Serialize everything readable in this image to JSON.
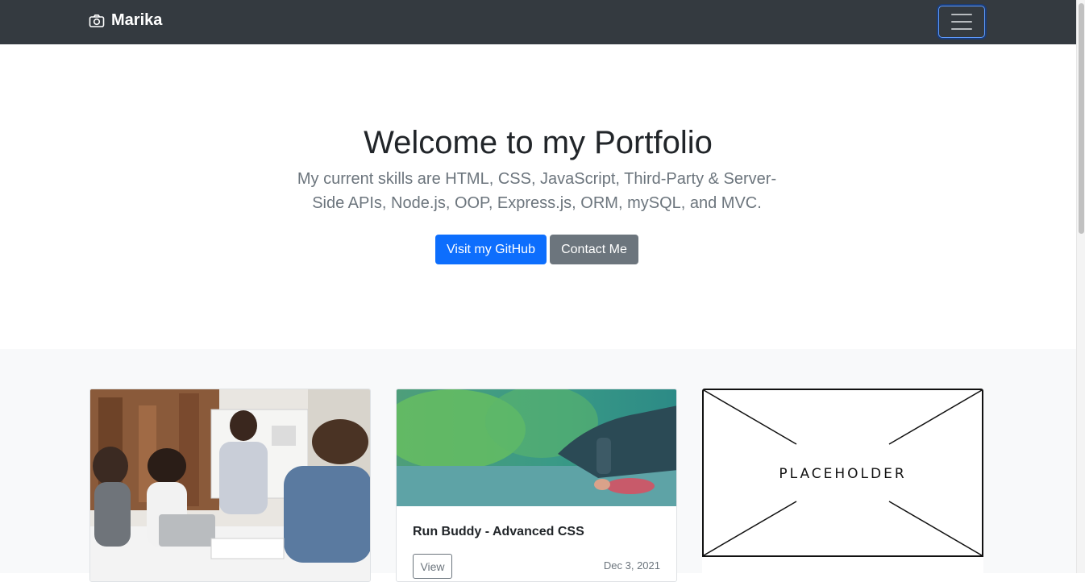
{
  "navbar": {
    "brand": "Marika",
    "brand_icon": "camera-icon",
    "toggler_icon": "hamburger-icon"
  },
  "hero": {
    "title": "Welcome to my Portfolio",
    "lead": "My current skills are HTML, CSS, JavaScript, Third-Party & Server-Side APIs, Node.js, OOP, Express.js, ORM, mySQL, and MVC.",
    "primary_button": "Visit my GitHub",
    "secondary_button": "Contact Me"
  },
  "cards": [
    {
      "image": "team-meeting-photo"
    },
    {
      "image": "runner-tying-shoe-photo",
      "title": "Run Buddy - Advanced CSS",
      "button": "View",
      "date": "Dec 3, 2021"
    },
    {
      "image": "placeholder-image",
      "placeholder_label": "PLACEHOLDER"
    }
  ],
  "colors": {
    "navbar_bg": "#343a40",
    "primary": "#0d6efd",
    "secondary": "#6c757d",
    "section_bg": "#f8f9fa"
  }
}
